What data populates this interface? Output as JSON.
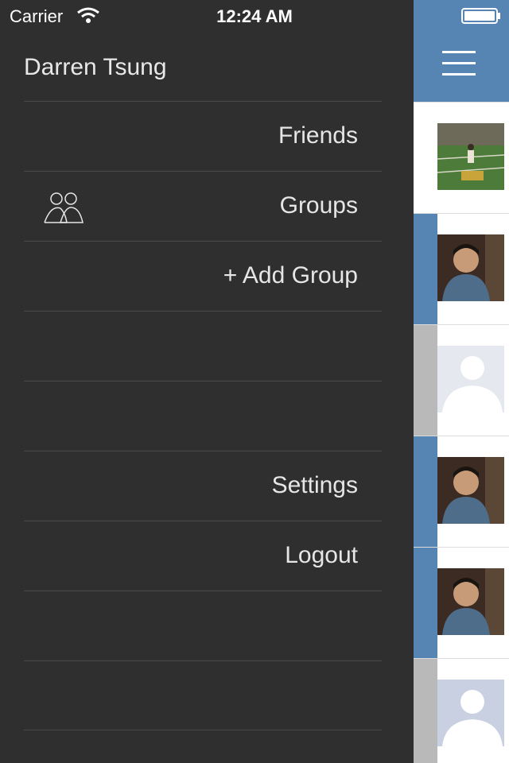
{
  "status": {
    "carrier": "Carrier",
    "time": "12:24 AM"
  },
  "drawer": {
    "user_name": "Darren Tsung",
    "items": [
      {
        "label": "Friends",
        "icon": ""
      },
      {
        "label": "Groups",
        "icon": "groups-icon"
      },
      {
        "label": "+ Add Group",
        "icon": ""
      },
      {
        "label": "",
        "icon": ""
      },
      {
        "label": "",
        "icon": ""
      },
      {
        "label": "Settings",
        "icon": ""
      },
      {
        "label": "Logout",
        "icon": ""
      },
      {
        "label": "",
        "icon": ""
      },
      {
        "label": "",
        "icon": ""
      }
    ]
  },
  "content": {
    "header_color": "#5684b3",
    "feed": [
      {
        "thumb": "field-photo",
        "stripe": "#ffffff"
      },
      {
        "thumb": "person-photo",
        "stripe": "#5684b3"
      },
      {
        "thumb": "default-avatar",
        "stripe": "#b9b9b9"
      },
      {
        "thumb": "person-photo",
        "stripe": "#5684b3"
      },
      {
        "thumb": "person-photo",
        "stripe": "#5684b3"
      },
      {
        "thumb": "default-avatar",
        "stripe": "#b9b9b9"
      }
    ]
  }
}
